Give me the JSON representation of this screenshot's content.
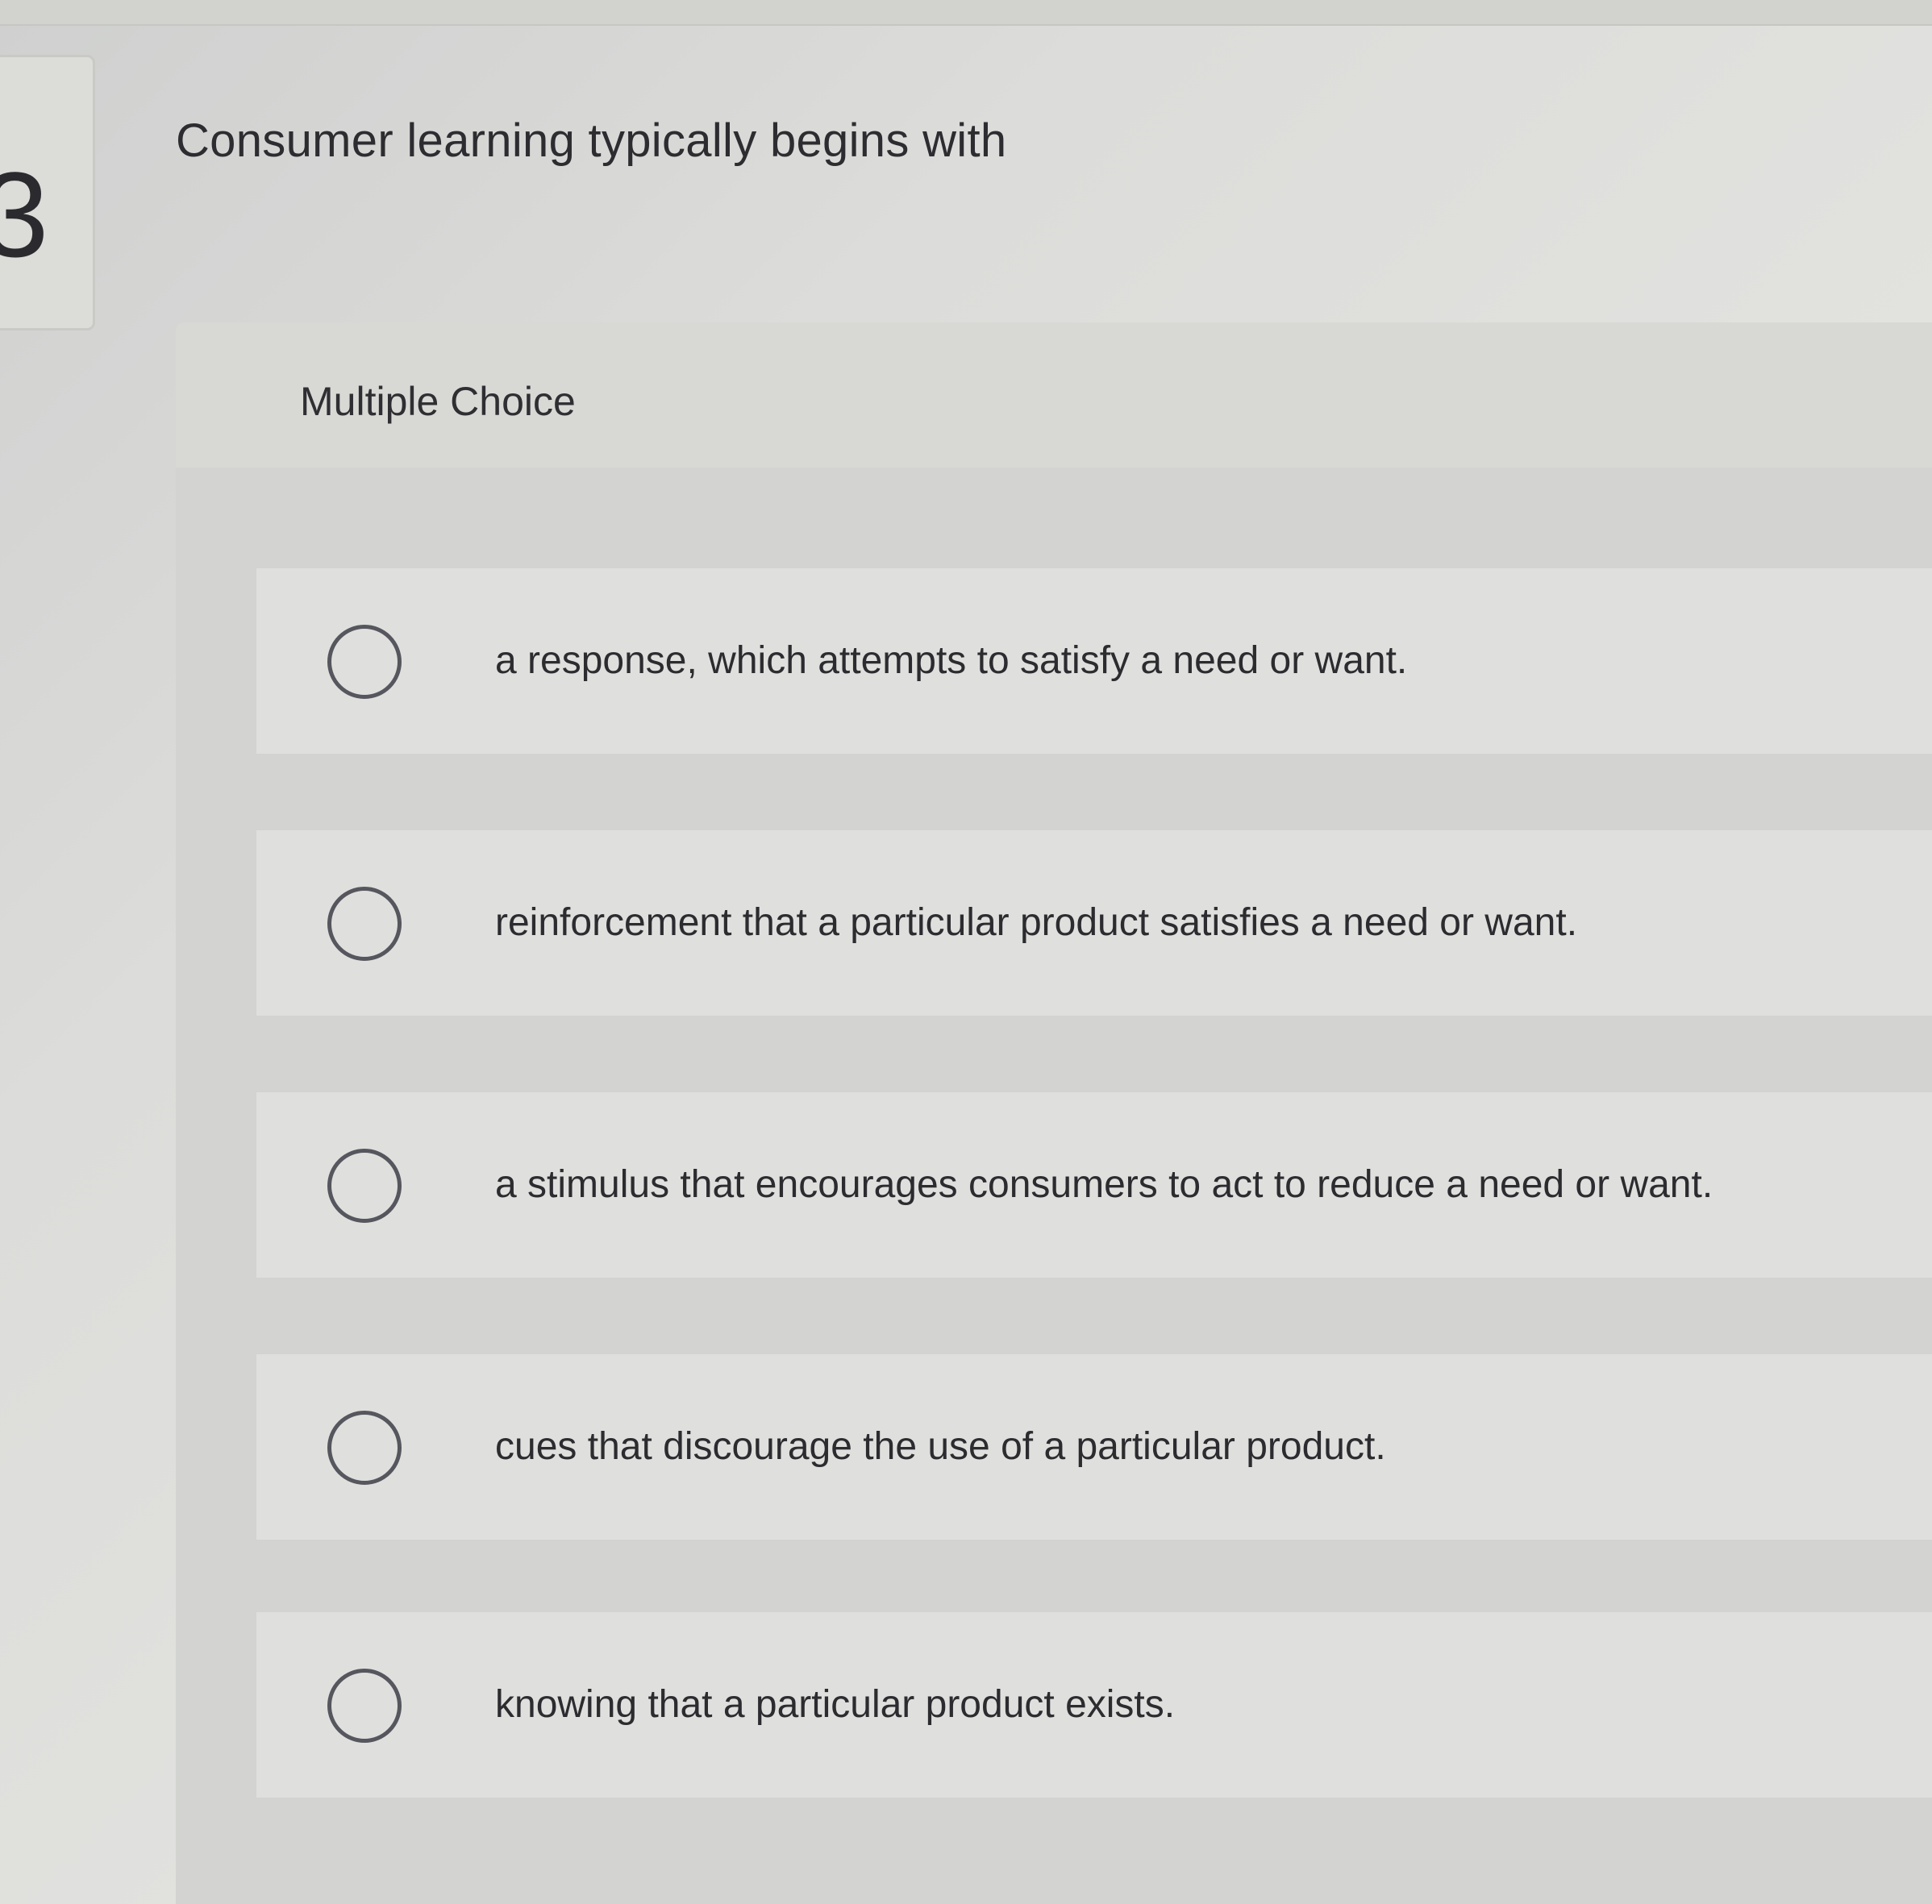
{
  "question": {
    "number": "3",
    "text": "Consumer learning typically begins with"
  },
  "answer_panel": {
    "title": "Multiple Choice",
    "options": [
      {
        "label": "a response, which attempts to satisfy a need or want."
      },
      {
        "label": "reinforcement that a particular product satisfies a need or want."
      },
      {
        "label": "a stimulus that encourages consumers to act to reduce a need or want."
      },
      {
        "label": "cues that discourage the use of a particular product."
      },
      {
        "label": "knowing that a particular product exists."
      }
    ]
  },
  "colors": {
    "background": "#dcdcda",
    "text": "#2c2c30",
    "radio_border": "#56565e",
    "option_row": "#dfe0dd"
  }
}
